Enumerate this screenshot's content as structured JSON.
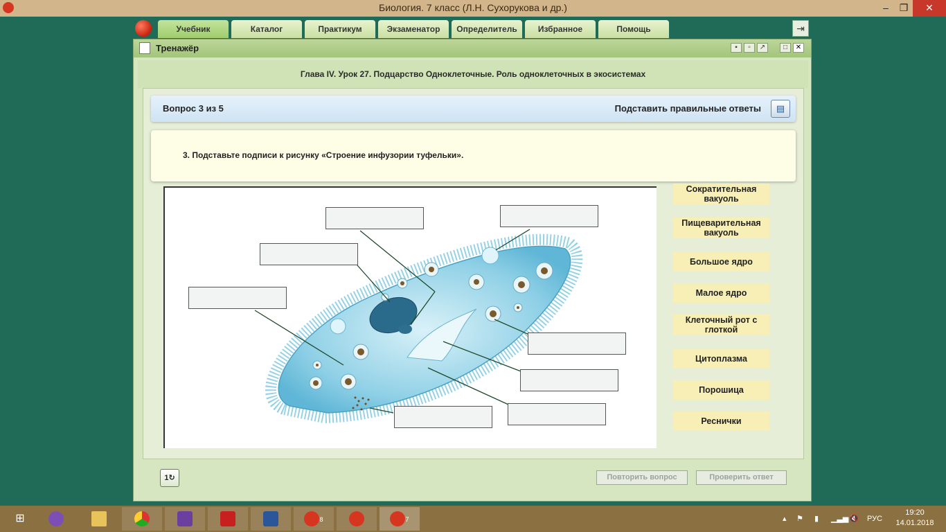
{
  "window": {
    "title": "Биология. 7 класс (Л.Н. Сухорукова и др.)",
    "min_label": "–",
    "max_label": "❐",
    "close_label": "✕"
  },
  "nav": {
    "tabs": [
      "Учебник",
      "Каталог",
      "Практикум",
      "Экзаменатор",
      "Определитель",
      "Избранное",
      "Помощь"
    ],
    "active_tab": "Учебник",
    "exit_icon": "exit-door-icon"
  },
  "panel": {
    "title": "Тренажёр",
    "chapter": "Глава IV. Урок 27. Подцарство Одноклеточные. Роль одноклеточных в экосистемах"
  },
  "question": {
    "counter": "Вопрос 3 из 5",
    "fill_answers_label": "Подставить правильные ответы",
    "text": "3. Подставьте подписи к рисунку «Строение инфузории туфельки»."
  },
  "figure": {
    "subject": "infusoria paramecium structure",
    "drop_slot_count": 8
  },
  "labels": [
    "Сократительная вакуоль",
    "Пищеварительная вакуоль",
    "Большое ядро",
    "Малое ядро",
    "Клеточный рот с глоткой",
    "Цитоплазма",
    "Порошица",
    "Реснички"
  ],
  "footer": {
    "replay_label": "1",
    "repeat_button": "Повторить вопрос",
    "check_button": "Проверить ответ"
  },
  "taskbar": {
    "apps": [
      "windows-start",
      "viber",
      "file-explorer",
      "chrome",
      "visual-studio",
      "acrobat",
      "word",
      "biology-app",
      "biology-app",
      "biology-app"
    ],
    "badges": [
      "8",
      "7"
    ],
    "language": "РУС",
    "time": "19:20",
    "date": "14.01.2018"
  },
  "colors": {
    "desktop_green": "#1f6b57",
    "title_bar": "#d2b58a",
    "tab_active": "#9fcd6c",
    "label_yellow": "#f7efb6",
    "taskbar": "#8b7042"
  }
}
